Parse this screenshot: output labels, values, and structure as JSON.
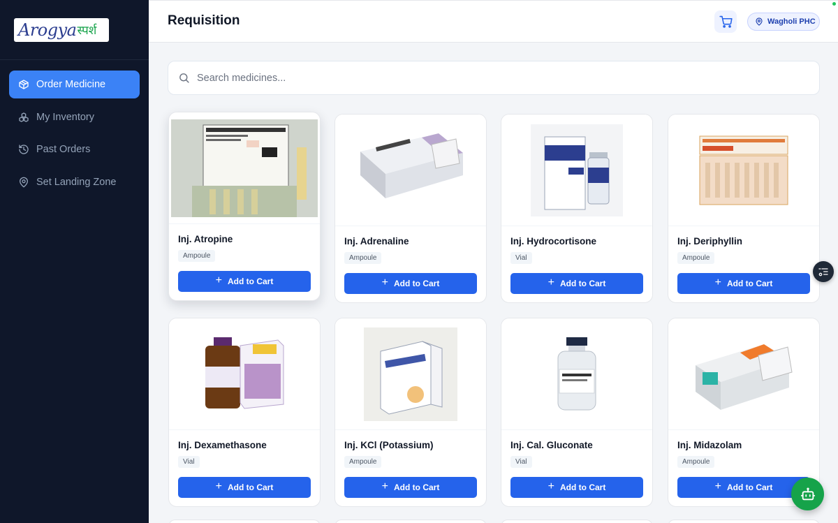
{
  "app": {
    "logo_main": "Arogya",
    "logo_sub": "स्पर्श"
  },
  "sidebar": {
    "items": [
      {
        "label": "Order Medicine",
        "icon": "package-icon",
        "active": true
      },
      {
        "label": "My Inventory",
        "icon": "boxes-icon",
        "active": false
      },
      {
        "label": "Past Orders",
        "icon": "history-icon",
        "active": false
      },
      {
        "label": "Set Landing Zone",
        "icon": "map-pin-icon",
        "active": false
      }
    ]
  },
  "header": {
    "title": "Requisition",
    "location": "Wagholi PHC"
  },
  "search": {
    "placeholder": "Search medicines..."
  },
  "products": [
    {
      "name": "Inj. Atropine",
      "form": "Ampoule",
      "add_label": "Add to Cart"
    },
    {
      "name": "Inj. Adrenaline",
      "form": "Ampoule",
      "add_label": "Add to Cart"
    },
    {
      "name": "Inj. Hydrocortisone",
      "form": "Vial",
      "add_label": "Add to Cart"
    },
    {
      "name": "Inj. Deriphyllin",
      "form": "Ampoule",
      "add_label": "Add to Cart"
    },
    {
      "name": "Inj. Dexamethasone",
      "form": "Vial",
      "add_label": "Add to Cart"
    },
    {
      "name": "Inj. KCl (Potassium)",
      "form": "Ampoule",
      "add_label": "Add to Cart"
    },
    {
      "name": "Inj. Cal. Gluconate",
      "form": "Vial",
      "add_label": "Add to Cart"
    },
    {
      "name": "Inj. Midazolam",
      "form": "Ampoule",
      "add_label": "Add to Cart"
    }
  ],
  "colors": {
    "sidebar_bg": "#0f172a",
    "accent": "#3b82f6",
    "button": "#2563eb",
    "bot_button": "#16a34a"
  }
}
